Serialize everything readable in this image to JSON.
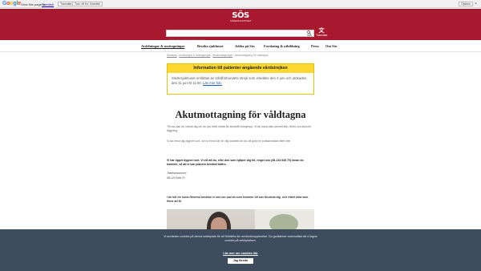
{
  "google_bar": {
    "logo": "Google",
    "view_text": "View this page in:",
    "language": "Swedish",
    "translate_label": "Translate",
    "turn_off_label": "Turn off for: Swedish",
    "options_label": "Options",
    "close_glyph": "×"
  },
  "header": {
    "logo_mark": "SÖS",
    "logo_sub": "SÖDERSJUKHUSET",
    "search_placeholder": "Sök på södersjukhuset.se",
    "search_label": "Sök",
    "translate_label": "Translate"
  },
  "nav": {
    "items": [
      {
        "label": "Avdelningar & mottagningar",
        "active": true
      },
      {
        "label": "Besöka sjukhuset",
        "active": false
      },
      {
        "label": "Jobba på Sös",
        "active": false
      },
      {
        "label": "Forskning & utbildning",
        "active": false
      },
      {
        "label": "Press",
        "active": false
      },
      {
        "label": "Om Sös",
        "active": false
      }
    ]
  },
  "breadcrumb": {
    "items": [
      "Startsida",
      "Avdelningar & mottagningar",
      "Akutmottagningar",
      "Akutmottagning för våldtagna"
    ],
    "separator": "›"
  },
  "notice": {
    "title": "Information till patienter angående vårdstrejken",
    "body": "Södersjukhuset omfattas av Vårdförbundets strejk som inleddes den 4 juni och utökades den 11 juni kl 11.00.",
    "link": "Läs mer här."
  },
  "main": {
    "title": "Akutmottagning för våldtagna",
    "para1": "Till oss kan du vända dig om du har blivit utsatt för sexuellt övergrepp. Vi tar emot alla oavsett kön, ålder och sexuell läggning.",
    "para2": "Vi tar emot dig dygnet runt, och vi finns här för dig oavsett om du vill göra en polisanmälan eller inte.",
    "bold_para": "Vi har öppet dygnet runt. Vi vill att du, eller den som hjälper dig hit, ringer oss (08-123 646 70) innan du kommer, så att vi kan planera besöket bättre.",
    "phone_label": "Telefonnummer:",
    "phone_value": "08-123 646 70",
    "quote": "I de här tre korta filmerna berättar vi mer om vad du som kommer hit kan förvänta dig, och vilket stöd som finns att få."
  },
  "cookie": {
    "text": "Vi använder cookies på denna webbplats för att förbättra din användarupplevelse. Du godkänner automatiskt att vi lagrar cookies på webbplatsen.",
    "link": "Läs mer om cookies här",
    "button": "Jag förstår"
  },
  "colors": {
    "brand_red": "#a8192f",
    "notice_yellow": "#fcd72f",
    "cookie_bg": "#3e4d5e"
  }
}
